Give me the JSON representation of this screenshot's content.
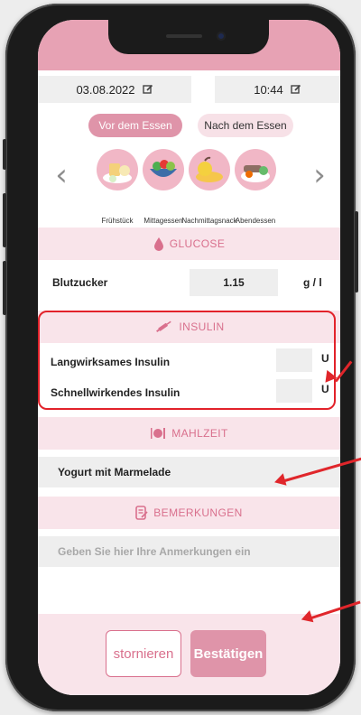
{
  "header": {
    "date": "03.08.2022",
    "time": "10:44"
  },
  "timing": {
    "before_label": "Vor dem Essen",
    "after_label": "Nach dem Essen",
    "selected": "before"
  },
  "meals": [
    {
      "label": "Frühstück",
      "icon": "breakfast-icon"
    },
    {
      "label": "Mittagessen",
      "icon": "lunch-icon"
    },
    {
      "label": "Nachmittagsnack",
      "icon": "snack-icon"
    },
    {
      "label": "Abendessen",
      "icon": "dinner-icon"
    }
  ],
  "glucose": {
    "title": "GLUCOSE",
    "label": "Blutzucker",
    "value": "1.15",
    "unit": "g / l"
  },
  "insulin": {
    "title": "INSULIN",
    "long_label": "Langwirksames Insulin",
    "long_unit": "U",
    "fast_label": "Schnellwirkendes Insulin",
    "fast_unit": "U"
  },
  "meal": {
    "title": "MAHLZEIT",
    "value": "Yogurt mit Marmelade"
  },
  "remarks": {
    "title": "BEMERKUNGEN",
    "placeholder": "Geben Sie hier Ihre Anmerkungen ein"
  },
  "actions": {
    "cancel": "stornieren",
    "confirm": "Bestätigen"
  },
  "colors": {
    "accent": "#df94a9",
    "accent_text": "#d9708d",
    "band": "#f9e4ea",
    "annotation": "#e0262b"
  }
}
